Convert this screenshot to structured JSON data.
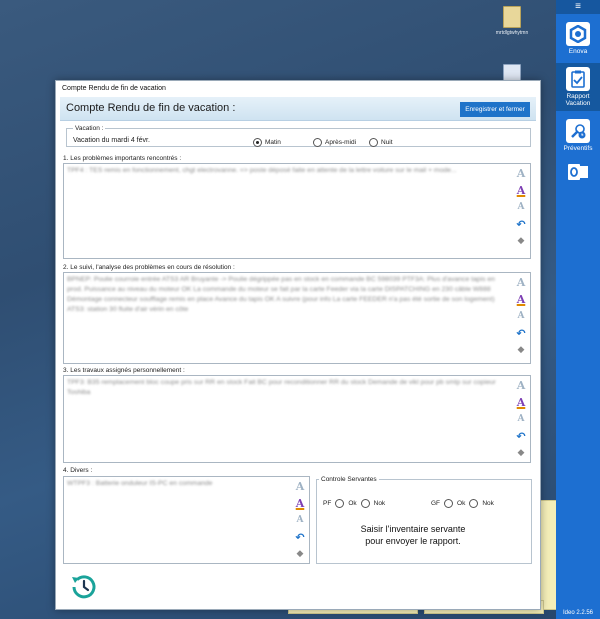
{
  "desktop": {
    "icon_label": "mrtdlgtwhytmn"
  },
  "sidebar": {
    "menu_glyph": "≡",
    "items": [
      {
        "label": "Enova",
        "icon": "enova-icon"
      },
      {
        "label": "Rapport Vacation",
        "icon": "clipboard-check-icon"
      },
      {
        "label": "Préventifs",
        "icon": "wrench-clock-icon"
      },
      {
        "label": "",
        "icon": "outlook-icon"
      }
    ],
    "version": "Ideo 2.2.56",
    "accent": "#1d6fd1"
  },
  "window": {
    "title": "Compte Rendu de fin de vacation",
    "header_title": "Compte Rendu de fin de vacation :",
    "save_label": "Enregistrer et fermer"
  },
  "vacation": {
    "legend": "Vacation :",
    "text": "Vacation du mardi 4 févr.",
    "options": [
      "Matin",
      "Après-midi",
      "Nuit"
    ],
    "selected": "Matin"
  },
  "sections": [
    {
      "label": "1. Les problèmes importants rencontrés :",
      "text": "TPF4 : TES remis en fonctionnement, chgt electrovanne. => poste déposé faite en attente de la lettre voiture sur le mail + mode..."
    },
    {
      "label": "2. Le suivi, l'analyse des problèmes en cours de résolution :",
      "text": "BPNEP: Poulie courroie entrée ATS3 AR Bruyante -> Poulie dégrippée pas en stock en commande BC 598039 PTF3A: Plus d'avance tapis en prod. Puissance au niveau du moteur OK La commande du moteur se fait par la carte Feeder via la carte DISPATCHING en 230 câble W888 Démontage connecteur soufflage remis en place Avance du tapis OK A suivre (pour info La carte FEEDER n'a pas été sortie de son logement) ATS3: station 30 fluite d'air vérin en côte"
    },
    {
      "label": "3. Les travaux assignés personnellement :",
      "text": "TPF3: B35 remplacement bloc coupe pris sur RR en stock Fait BC pour reconditionner RR du stock Demande de vikl pour pb smtp sur copieur Toshiba"
    },
    {
      "label": "4. Divers :",
      "text": "WTPF3 : Batterie onduleur IS-PC en commande"
    }
  ],
  "controle": {
    "legend": "Controle Servantes",
    "pf_label": "PF",
    "gf_label": "GF",
    "ok_label": "Ok",
    "nok_label": "Nok",
    "message": "Saisir l'inventaire servante pour envoyer le rapport."
  }
}
